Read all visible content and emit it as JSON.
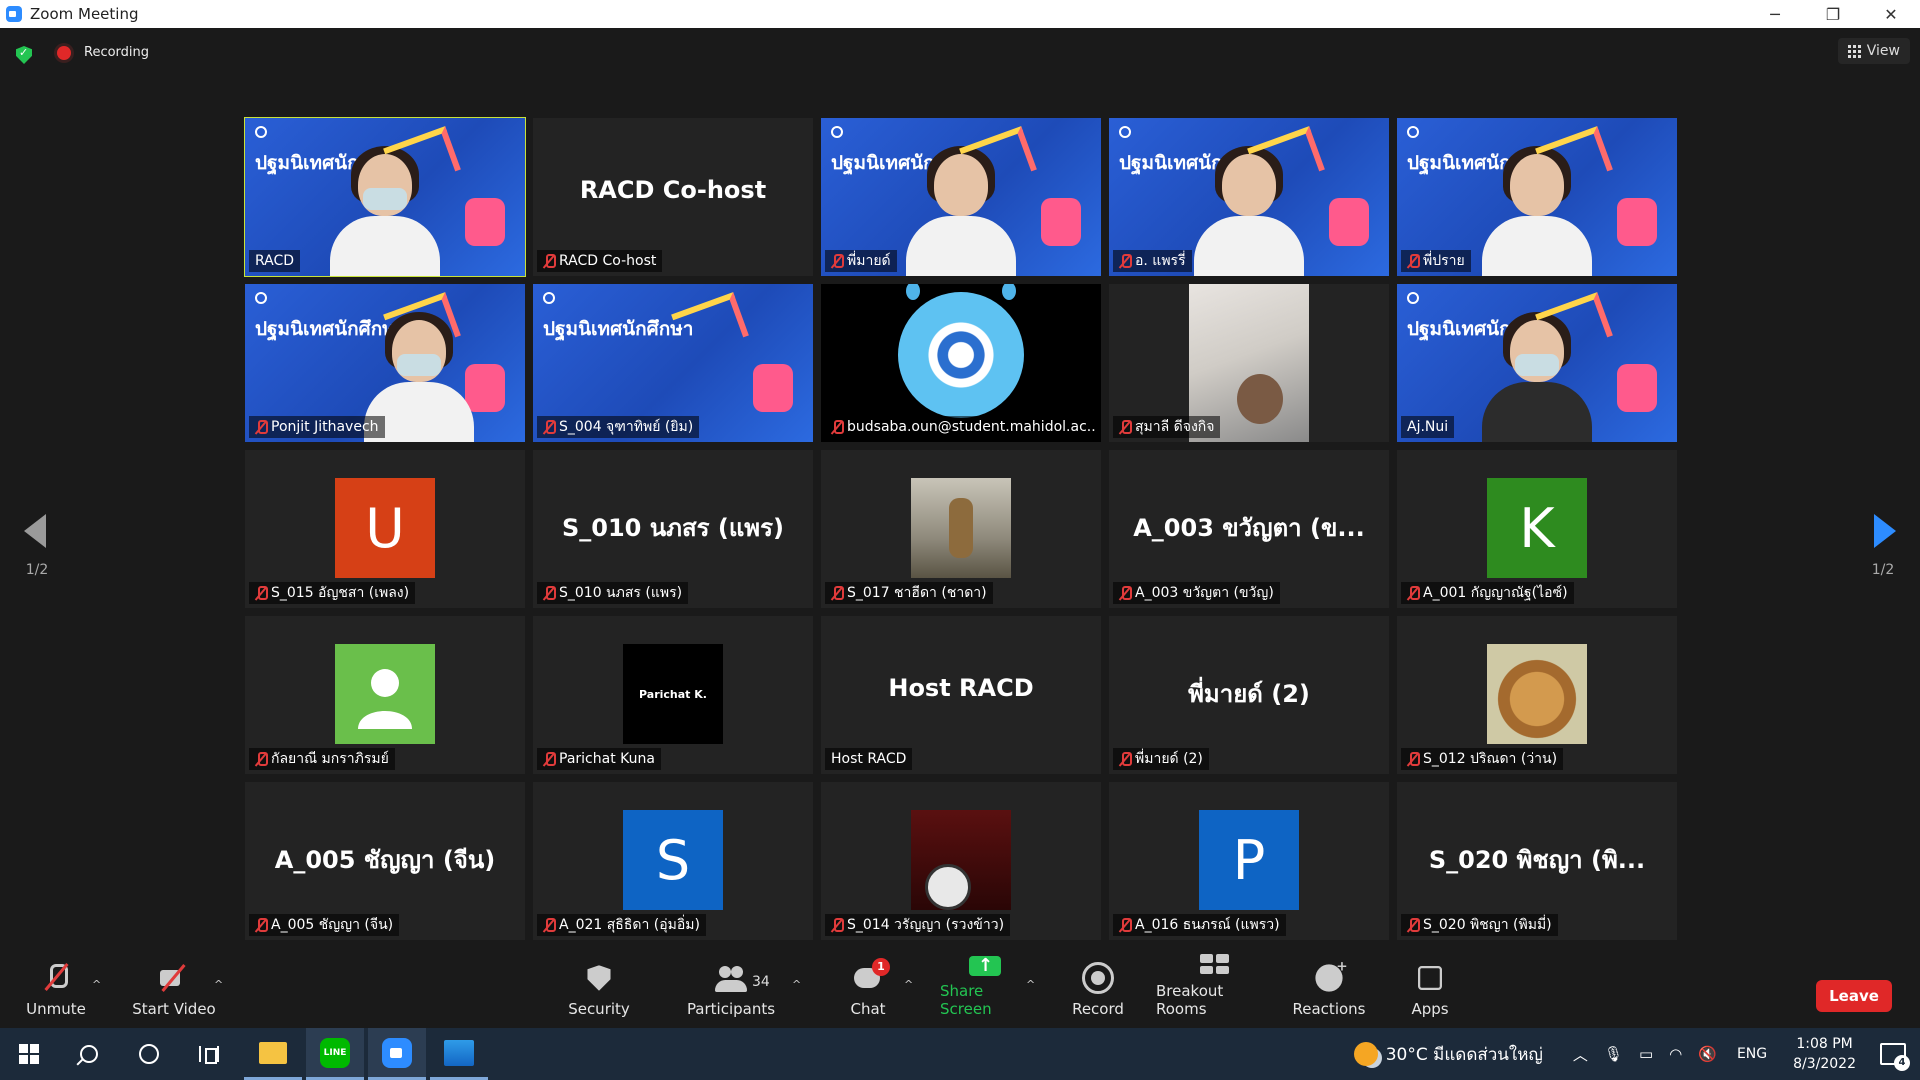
{
  "window": {
    "title": "Zoom Meeting"
  },
  "topbar": {
    "recording_label": "Recording",
    "view_label": "View"
  },
  "pager": {
    "left_label": "1/2",
    "right_label": "1/2"
  },
  "banner_text": "ปฐมนิเทศนักศึกษา",
  "tiles": [
    {
      "name": "RACD",
      "muted": false,
      "kind": "video"
    },
    {
      "name": "RACD Co-host",
      "muted": true,
      "kind": "name",
      "display": "RACD Co-host"
    },
    {
      "name": "พี่มายด์",
      "muted": true,
      "kind": "video"
    },
    {
      "name": "อ. แพรรี่",
      "muted": true,
      "kind": "video"
    },
    {
      "name": "พี่ปราย",
      "muted": true,
      "kind": "video"
    },
    {
      "name": "Ponjit Jithavech",
      "muted": true,
      "kind": "video"
    },
    {
      "name": "S_004 จุฑาทิพย์ (ยิม)",
      "muted": true,
      "kind": "video"
    },
    {
      "name": "budsaba.oun@student.mahidol.ac...",
      "muted": true,
      "kind": "image"
    },
    {
      "name": "สุมาลี ดีจงกิจ",
      "muted": true,
      "kind": "video"
    },
    {
      "name": "Aj.Nui",
      "muted": false,
      "kind": "video"
    },
    {
      "name": "S_015 อัญชสา (เพลง)",
      "muted": true,
      "kind": "avatar",
      "letter": "U",
      "color": "#d64016"
    },
    {
      "name": "S_010 นภสร (แพร)",
      "muted": true,
      "kind": "name",
      "display": "S_010 นภสร (แพร)"
    },
    {
      "name": "S_017 ชาฮีดา (ชาดา)",
      "muted": true,
      "kind": "photo"
    },
    {
      "name": "A_003 ขวัญตา (ขวัญ)",
      "muted": true,
      "kind": "name",
      "display": "A_003 ขวัญตา (ข..."
    },
    {
      "name": "A_001 กัญญาณัฐ(ไอซ์)",
      "muted": true,
      "kind": "avatar",
      "letter": "K",
      "color": "#2e8b1f"
    },
    {
      "name": "กัลยาณี มกราภิรมย์",
      "muted": true,
      "kind": "default-avatar",
      "color": "#6abf4b"
    },
    {
      "name": "Parichat Kuna",
      "muted": true,
      "kind": "parichat",
      "display": "Parichat K."
    },
    {
      "name": "Host RACD",
      "muted": false,
      "kind": "name",
      "display": "Host RACD"
    },
    {
      "name": "พี่มายด์ (2)",
      "muted": true,
      "kind": "name",
      "display": "พี่มายด์ (2)"
    },
    {
      "name": "S_012 ปริณดา (ว่าน)",
      "muted": true,
      "kind": "photo-cat"
    },
    {
      "name": "A_005 ชัญญา (จีน)",
      "muted": true,
      "kind": "name",
      "display": "A_005 ชัญญา (จีน)"
    },
    {
      "name": "A_021 สุธิธิดา (อุ่มอิ่ม)",
      "muted": true,
      "kind": "avatar",
      "letter": "S",
      "color": "#0e64c4"
    },
    {
      "name": "S_014 วรัญญา (รวงข้าว)",
      "muted": true,
      "kind": "photo-clock"
    },
    {
      "name": "A_016 ธนภรณ์ (แพรว)",
      "muted": true,
      "kind": "avatar",
      "letter": "P",
      "color": "#0e64c4"
    },
    {
      "name": "S_020 พิชญา (พิมมี่)",
      "muted": true,
      "kind": "name",
      "display": "S_020 พิชญา (พิ..."
    }
  ],
  "toolbar": {
    "unmute": "Unmute",
    "start_video": "Start Video",
    "security": "Security",
    "participants": "Participants",
    "participants_count": "34",
    "chat": "Chat",
    "chat_badge": "1",
    "share_screen": "Share Screen",
    "record": "Record",
    "breakout_rooms": "Breakout Rooms",
    "reactions": "Reactions",
    "apps": "Apps",
    "leave": "Leave"
  },
  "taskbar": {
    "line_label": "LINE",
    "weather": "30°C มีแดดส่วนใหญ่",
    "language": "ENG",
    "time": "1:08 PM",
    "date": "8/3/2022",
    "notification_count": "4"
  }
}
